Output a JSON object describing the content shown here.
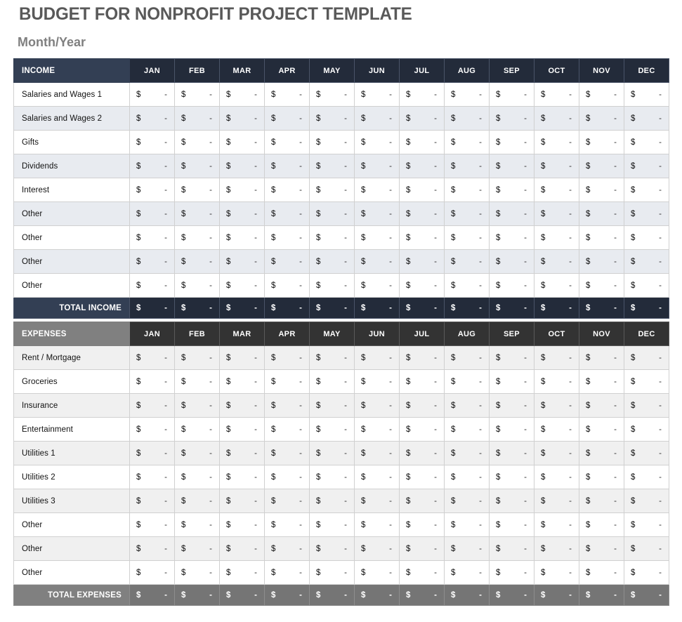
{
  "header": {
    "title": "BUDGET FOR NONPROFIT PROJECT TEMPLATE",
    "subtitle": "Month/Year"
  },
  "months": [
    "JAN",
    "FEB",
    "MAR",
    "APR",
    "MAY",
    "JUN",
    "JUL",
    "AUG",
    "SEP",
    "OCT",
    "NOV",
    "DEC"
  ],
  "cell": {
    "currency_symbol": "$",
    "empty_value": "-"
  },
  "income_table": {
    "header_label": "INCOME",
    "rows": [
      "Salaries and Wages 1",
      "Salaries and Wages 2",
      "Gifts",
      "Dividends",
      "Interest",
      "Other",
      "Other",
      "Other",
      "Other"
    ],
    "total_label": "TOTAL INCOME",
    "values": [
      [
        "-",
        "-",
        "-",
        "-",
        "-",
        "-",
        "-",
        "-",
        "-",
        "-",
        "-",
        "-"
      ],
      [
        "-",
        "-",
        "-",
        "-",
        "-",
        "-",
        "-",
        "-",
        "-",
        "-",
        "-",
        "-"
      ],
      [
        "-",
        "-",
        "-",
        "-",
        "-",
        "-",
        "-",
        "-",
        "-",
        "-",
        "-",
        "-"
      ],
      [
        "-",
        "-",
        "-",
        "-",
        "-",
        "-",
        "-",
        "-",
        "-",
        "-",
        "-",
        "-"
      ],
      [
        "-",
        "-",
        "-",
        "-",
        "-",
        "-",
        "-",
        "-",
        "-",
        "-",
        "-",
        "-"
      ],
      [
        "-",
        "-",
        "-",
        "-",
        "-",
        "-",
        "-",
        "-",
        "-",
        "-",
        "-",
        "-"
      ],
      [
        "-",
        "-",
        "-",
        "-",
        "-",
        "-",
        "-",
        "-",
        "-",
        "-",
        "-",
        "-"
      ],
      [
        "-",
        "-",
        "-",
        "-",
        "-",
        "-",
        "-",
        "-",
        "-",
        "-",
        "-",
        "-"
      ],
      [
        "-",
        "-",
        "-",
        "-",
        "-",
        "-",
        "-",
        "-",
        "-",
        "-",
        "-",
        "-"
      ]
    ],
    "totals": [
      "-",
      "-",
      "-",
      "-",
      "-",
      "-",
      "-",
      "-",
      "-",
      "-",
      "-",
      "-"
    ]
  },
  "expenses_table": {
    "header_label": "EXPENSES",
    "rows": [
      "Rent / Mortgage",
      "Groceries",
      "Insurance",
      "Entertainment",
      "Utilities 1",
      "Utilities 2",
      "Utilities 3",
      "Other",
      "Other",
      "Other"
    ],
    "total_label": "TOTAL EXPENSES",
    "values": [
      [
        "-",
        "-",
        "-",
        "-",
        "-",
        "-",
        "-",
        "-",
        "-",
        "-",
        "-",
        "-"
      ],
      [
        "-",
        "-",
        "-",
        "-",
        "-",
        "-",
        "-",
        "-",
        "-",
        "-",
        "-",
        "-"
      ],
      [
        "-",
        "-",
        "-",
        "-",
        "-",
        "-",
        "-",
        "-",
        "-",
        "-",
        "-",
        "-"
      ],
      [
        "-",
        "-",
        "-",
        "-",
        "-",
        "-",
        "-",
        "-",
        "-",
        "-",
        "-",
        "-"
      ],
      [
        "-",
        "-",
        "-",
        "-",
        "-",
        "-",
        "-",
        "-",
        "-",
        "-",
        "-",
        "-"
      ],
      [
        "-",
        "-",
        "-",
        "-",
        "-",
        "-",
        "-",
        "-",
        "-",
        "-",
        "-",
        "-"
      ],
      [
        "-",
        "-",
        "-",
        "-",
        "-",
        "-",
        "-",
        "-",
        "-",
        "-",
        "-",
        "-"
      ],
      [
        "-",
        "-",
        "-",
        "-",
        "-",
        "-",
        "-",
        "-",
        "-",
        "-",
        "-",
        "-"
      ],
      [
        "-",
        "-",
        "-",
        "-",
        "-",
        "-",
        "-",
        "-",
        "-",
        "-",
        "-",
        "-"
      ],
      [
        "-",
        "-",
        "-",
        "-",
        "-",
        "-",
        "-",
        "-",
        "-",
        "-",
        "-",
        "-"
      ]
    ],
    "totals": [
      "-",
      "-",
      "-",
      "-",
      "-",
      "-",
      "-",
      "-",
      "-",
      "-",
      "-",
      "-"
    ]
  },
  "colors": {
    "title_text": "#595959",
    "subtitle_text": "#808080",
    "income_header_label_bg": "#333f54",
    "income_header_month_bg": "#232b3a",
    "income_alt_row_bg": "#e8ebf0",
    "expenses_header_label_bg": "#808080",
    "expenses_header_month_bg": "#333333",
    "expenses_alt_row_bg": "#f0f0f0",
    "gridline": "#d0d0d0"
  }
}
